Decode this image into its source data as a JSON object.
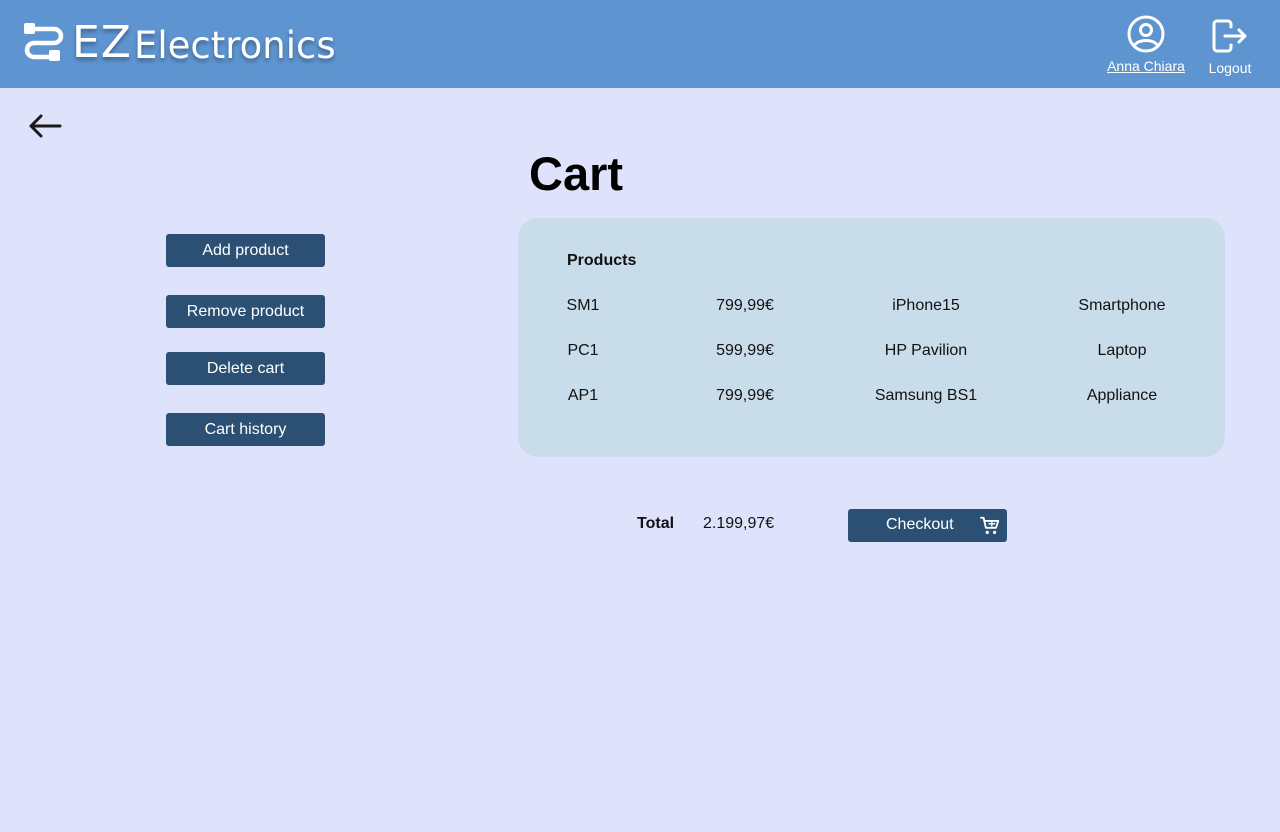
{
  "header": {
    "logo_prefix": "EZ",
    "logo_suffix": "Electronics",
    "user_name": "Anna Chiara",
    "logout_label": "Logout",
    "logo_icon": "cable-icon",
    "user_icon": "user-circle-icon",
    "logout_icon": "logout-icon",
    "background_color": "#5e95d1"
  },
  "nav": {
    "back_icon": "arrow-left-icon"
  },
  "page": {
    "title": "Cart",
    "background_color": "#dee3fb"
  },
  "actions": {
    "add_product": "Add product",
    "remove_product": "Remove product",
    "delete_cart": "Delete cart",
    "cart_history": "Cart history",
    "button_color": "#2b5074"
  },
  "products": {
    "heading": "Products",
    "items": [
      {
        "code": "SM1",
        "price": "799,99€",
        "name": "iPhone15",
        "category": "Smartphone"
      },
      {
        "code": "PC1",
        "price": "599,99€",
        "name": "HP Pavilion",
        "category": "Laptop"
      },
      {
        "code": "AP1",
        "price": "799,99€",
        "name": "Samsung BS1",
        "category": "Appliance"
      }
    ],
    "panel_color": "#c9dcea"
  },
  "summary": {
    "total_label": "Total",
    "total_value": "2.199,97€",
    "checkout_label": "Checkout",
    "checkout_icon": "cart-icon"
  }
}
